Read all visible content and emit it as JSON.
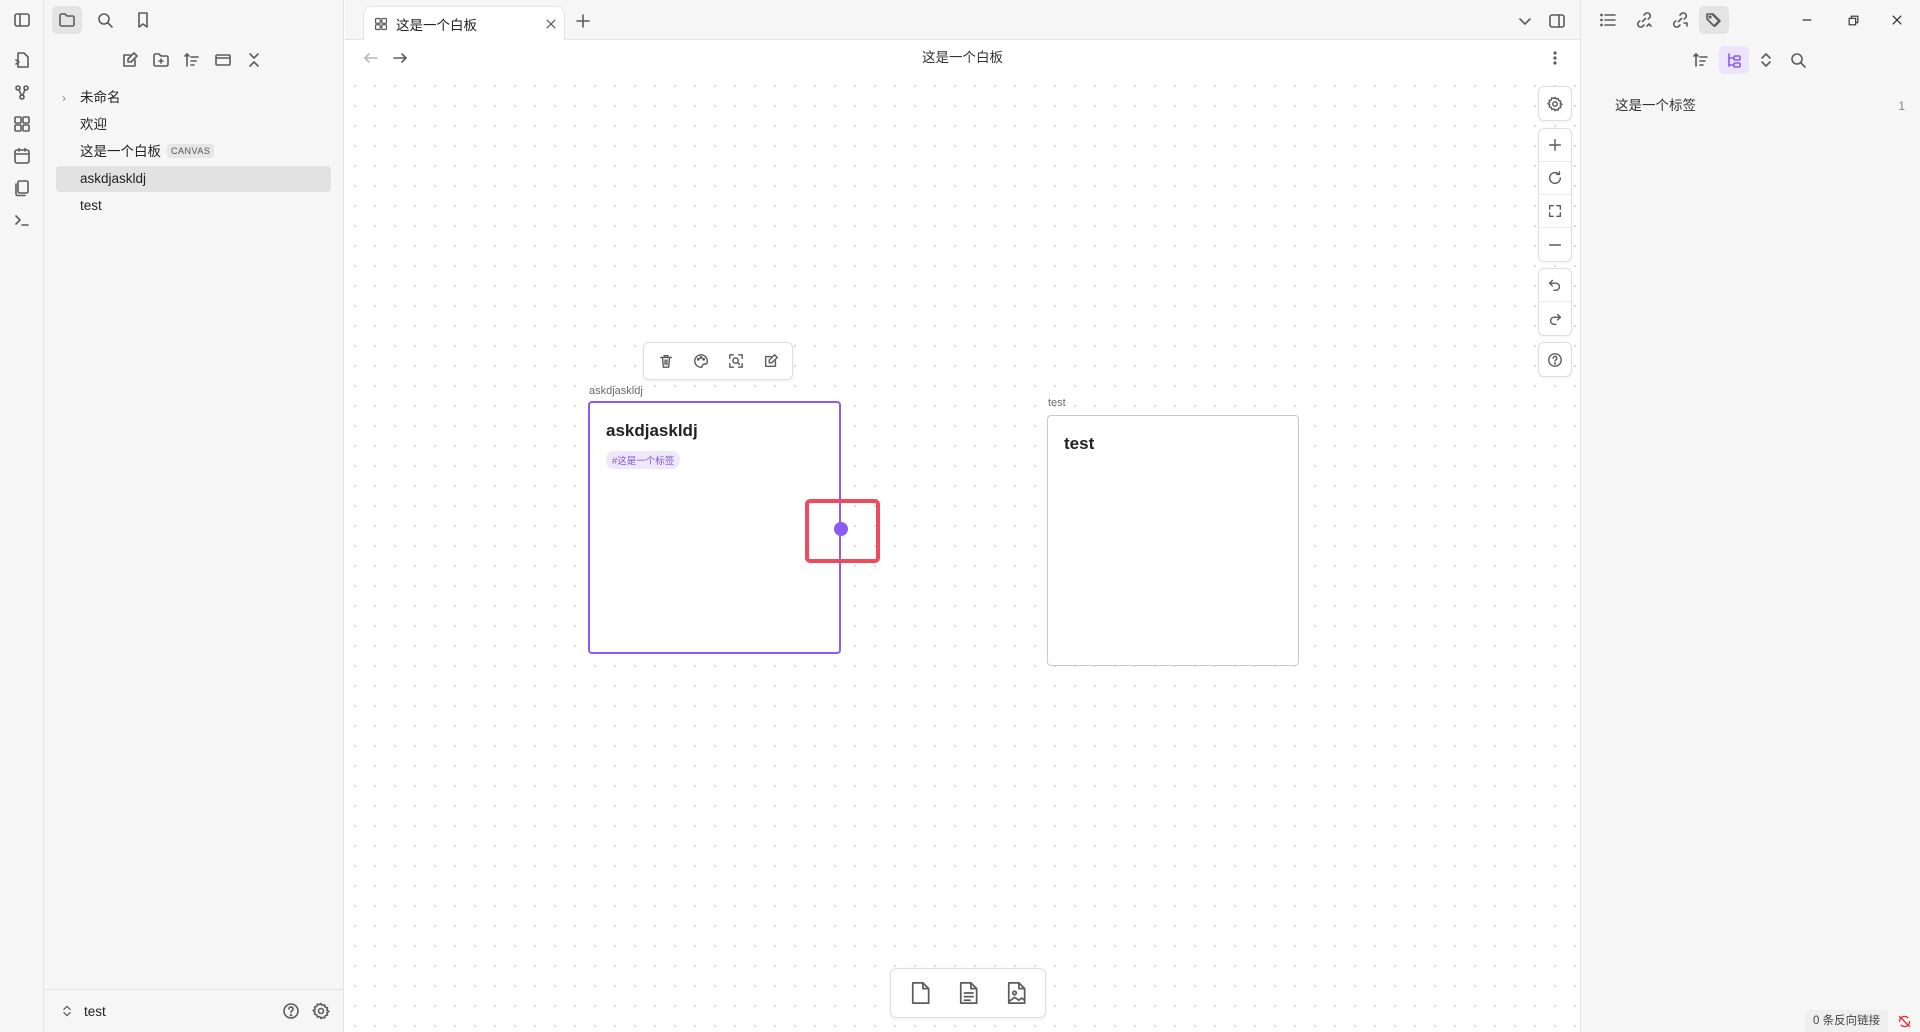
{
  "ribbon": {
    "icons": [
      "open-quick-switcher-icon",
      "graph-view-icon",
      "canvas-icon",
      "daily-notes-icon",
      "templates-icon",
      "command-palette-icon"
    ]
  },
  "left_sidebar": {
    "tree": [
      {
        "label": "未命名",
        "type": "folder",
        "collapsed": true
      },
      {
        "label": "欢迎",
        "type": "file"
      },
      {
        "label": "这是一个白板",
        "type": "canvas",
        "badge": "CANVAS"
      },
      {
        "label": "askdjaskldj",
        "type": "file",
        "selected": true
      },
      {
        "label": "test",
        "type": "file"
      }
    ],
    "vault_name": "test"
  },
  "main": {
    "tab_title": "这是一个白板",
    "view_title": "这是一个白板",
    "canvas": {
      "nodes": [
        {
          "label": "askdjaskldj",
          "title": "askdjaskldj",
          "tag": "#这是一个标签",
          "selected": true
        },
        {
          "label": "test",
          "title": "test",
          "selected": false
        }
      ]
    }
  },
  "right_sidebar": {
    "tags": [
      {
        "name": "这是一个标签",
        "count": "1"
      }
    ],
    "status_backlinks": "0 条反向链接"
  },
  "colors": {
    "accent": "#8a5cf5",
    "highlight_box": "#ef4b5e"
  }
}
